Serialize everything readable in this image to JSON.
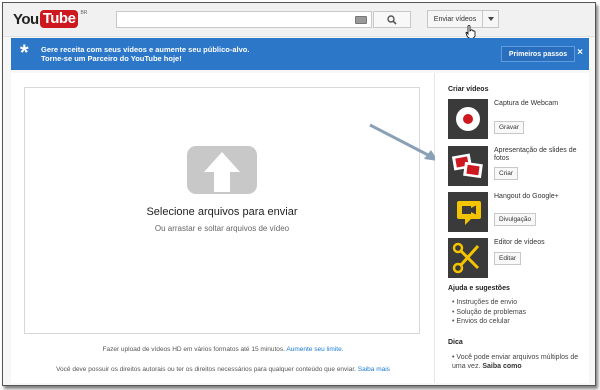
{
  "header": {
    "logo_you": "You",
    "logo_tube": "Tube",
    "logo_region": "BR",
    "search_value": "",
    "upload_label": "Enviar vídeos"
  },
  "banner": {
    "line1": "Gere receita com seus vídeos e aumente seu público-alvo.",
    "line2": "Torne-se um Parceiro do YouTube hoje!",
    "button_label": "Primeiros passos",
    "close": "×"
  },
  "upload": {
    "title": "Selecione arquivos para enviar",
    "subtitle": "Ou arrastar e soltar arquivos de vídeo",
    "hd_text": "Fazer upload de vídeos HD em vários formatos até 15 minutos.",
    "hd_link": "Aumente seu limite.",
    "rights_text": "Você deve possuir os direitos autorais ou ter os direitos necessários para qualquer conteúdo que enviar.",
    "rights_link": "Saiba mais"
  },
  "sidebar": {
    "create_heading": "Criar vídeos",
    "options": [
      {
        "label": "Captura de Webcam",
        "button": "Gravar"
      },
      {
        "label": "Apresentação de slides de fotos",
        "button": "Criar"
      },
      {
        "label": "Hangout do Google+",
        "button": "Divulgação"
      },
      {
        "label": "Editor de vídeos",
        "button": "Editar"
      }
    ],
    "help_heading": "Ajuda e sugestões",
    "help_links": [
      "Instruções de envio",
      "Solução de problemas",
      "Envios do celular"
    ],
    "tip_heading": "Dica",
    "tip_text": "Você pode enviar arquivos múltiplos de uma vez.",
    "tip_link": "Saiba como"
  },
  "colors": {
    "banner_bg": "#2c77c7",
    "link": "#1b7bd6",
    "logo_red": "#cc181e"
  }
}
